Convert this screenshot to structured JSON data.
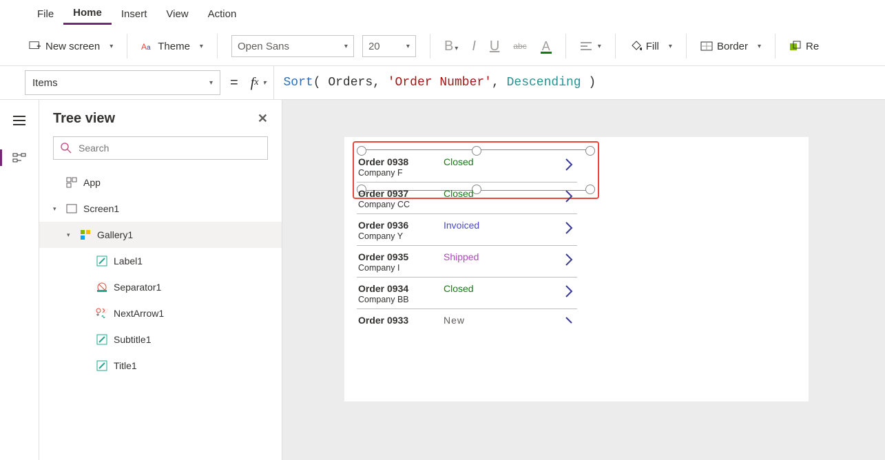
{
  "menubar": {
    "items": [
      "File",
      "Home",
      "Insert",
      "View",
      "Action"
    ],
    "active_index": 1
  },
  "ribbon": {
    "new_screen": "New screen",
    "theme": "Theme",
    "font_family": "Open Sans",
    "font_size": "20",
    "bold": "B",
    "italic": "I",
    "underline": "U",
    "strike": "abc",
    "font_color": "A",
    "fill": "Fill",
    "border": "Border",
    "reorder": "Re"
  },
  "formula": {
    "property": "Items",
    "tokens": {
      "fn": "Sort",
      "open": "( ",
      "arg1": "Orders",
      "sep1": ", ",
      "arg2": "'Order Number'",
      "sep2": ", ",
      "arg3": "Descending",
      "close": " )"
    }
  },
  "tree_panel": {
    "title": "Tree view",
    "search_placeholder": "Search",
    "nodes": {
      "app": "App",
      "screen1": "Screen1",
      "gallery1": "Gallery1",
      "label1": "Label1",
      "separator1": "Separator1",
      "nextarrow1": "NextArrow1",
      "subtitle1": "Subtitle1",
      "title1": "Title1"
    }
  },
  "gallery_rows": [
    {
      "title": "Order 0938",
      "sub": "Company F",
      "status": "Closed",
      "status_class": "status-Closed"
    },
    {
      "title": "Order 0937",
      "sub": "Company CC",
      "status": "Closed",
      "status_class": "status-Closed"
    },
    {
      "title": "Order 0936",
      "sub": "Company Y",
      "status": "Invoiced",
      "status_class": "status-Invoiced"
    },
    {
      "title": "Order 0935",
      "sub": "Company I",
      "status": "Shipped",
      "status_class": "status-Shipped"
    },
    {
      "title": "Order 0934",
      "sub": "Company BB",
      "status": "Closed",
      "status_class": "status-Closed"
    },
    {
      "title": "Order 0933",
      "sub": "",
      "status": "New",
      "status_class": "status-New"
    }
  ]
}
